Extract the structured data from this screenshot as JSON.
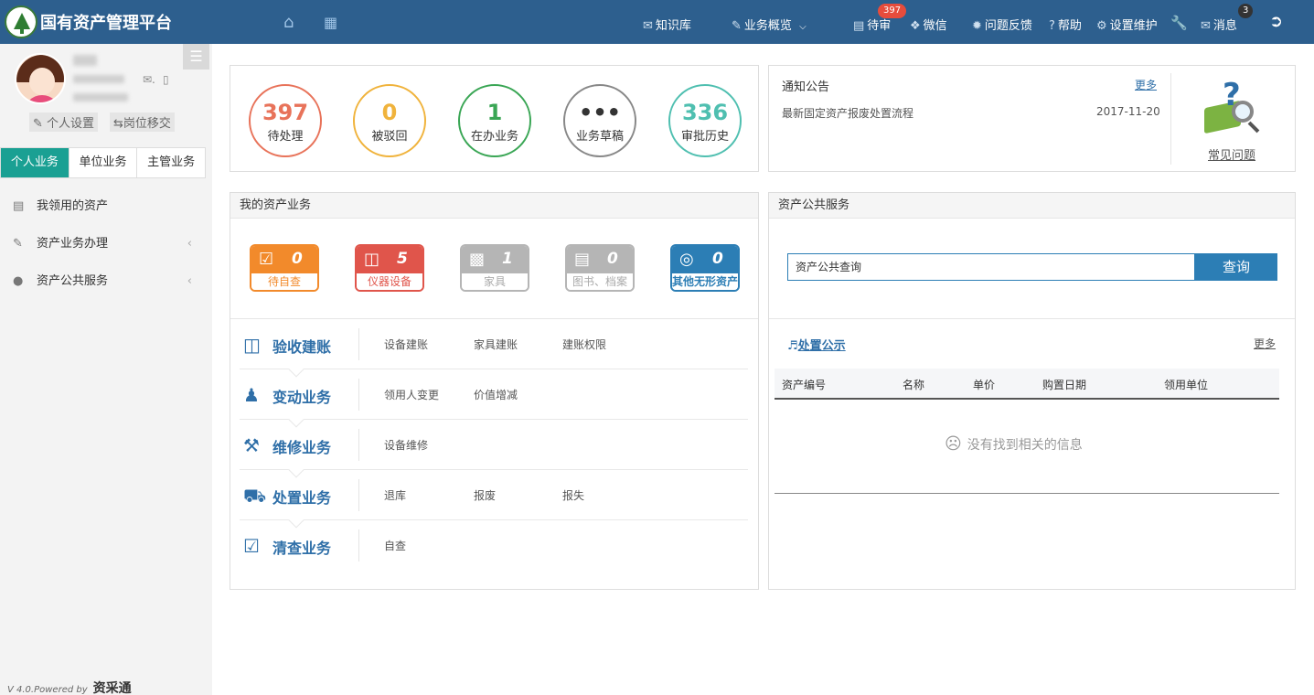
{
  "brand": {
    "title": "国有资产管理平台"
  },
  "nav": {
    "knowledge": "知识库",
    "overview": "业务概览",
    "pending": "待审",
    "pending_badge": "397",
    "wechat": "微信",
    "feedback": "问题反馈",
    "help": "帮助",
    "settings": "设置维护",
    "messages": "消息",
    "messages_badge": "3"
  },
  "sidebar": {
    "personal_settings": "个人设置",
    "transfer": "岗位移交",
    "tabs": [
      "个人业务",
      "单位业务",
      "主管业务"
    ],
    "items": [
      {
        "label": "我领用的资产",
        "icon": "hdd-icon"
      },
      {
        "label": "资产业务办理",
        "icon": "pencil-icon"
      },
      {
        "label": "资产公共服务",
        "icon": "globe-icon"
      }
    ],
    "version": "V 4.0.Powered by",
    "powered_brand": "资采通"
  },
  "stats": [
    {
      "value": "397",
      "label": "待处理",
      "color": "#e8735a"
    },
    {
      "value": "0",
      "label": "被驳回",
      "color": "#f0b33c"
    },
    {
      "value": "1",
      "label": "在办业务",
      "color": "#3aa655"
    },
    {
      "value": "•••",
      "label": "业务草稿",
      "color": "#888888"
    },
    {
      "value": "336",
      "label": "审批历史",
      "color": "#4fbfb0"
    }
  ],
  "notice": {
    "title": "通知公告",
    "more": "更多",
    "item_title": "最新固定资产报废处置流程",
    "item_date": "2017-11-20",
    "faq": "常见问题"
  },
  "my_business": {
    "title": "我的资产业务",
    "tiles": [
      {
        "value": "0",
        "label": "待自查",
        "color": "#f28a2b"
      },
      {
        "value": "5",
        "label": "仪器设备",
        "color": "#e0554b"
      },
      {
        "value": "1",
        "label": "家具",
        "color": "#b5b5b5"
      },
      {
        "value": "0",
        "label": "图书、档案",
        "color": "#b5b5b5"
      },
      {
        "value": "0",
        "label": "其他无形资产",
        "color": "#2c7eb5"
      }
    ],
    "rows": [
      {
        "title": "验收建账",
        "links": [
          "设备建账",
          "家具建账",
          "建账权限"
        ]
      },
      {
        "title": "变动业务",
        "links": [
          "领用人变更",
          "价值增减"
        ]
      },
      {
        "title": "维修业务",
        "links": [
          "设备维修"
        ]
      },
      {
        "title": "处置业务",
        "links": [
          "退库",
          "报废",
          "报失"
        ]
      },
      {
        "title": "清查业务",
        "links": [
          "自查"
        ]
      }
    ]
  },
  "public_service": {
    "title": "资产公共服务",
    "search_value": "资产公共查询",
    "search_button": "查询",
    "disposal_title": "处置公示",
    "disposal_more": "更多",
    "columns": [
      "资产编号",
      "名称",
      "单价",
      "购置日期",
      "领用单位"
    ],
    "empty": "没有找到相关的信息"
  }
}
